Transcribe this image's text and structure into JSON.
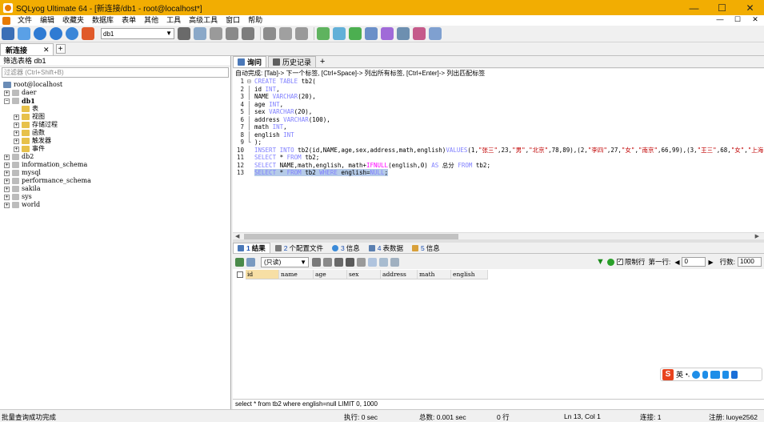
{
  "window": {
    "title": "SQLyog Ultimate 64 - [新连接/db1 - root@localhost*]",
    "minimize": "—",
    "maximize": "☐",
    "close": "✕"
  },
  "menu": {
    "items": [
      "文件",
      "编辑",
      "收藏夹",
      "数据库",
      "表单",
      "其他",
      "工具",
      "高级工具",
      "窗口",
      "帮助"
    ],
    "right": [
      "—",
      "☐",
      "✕"
    ]
  },
  "toolbar": {
    "db_select": "db1"
  },
  "connection_tab": {
    "label": "新连接",
    "close": "✕",
    "add": "+"
  },
  "left_panel": {
    "header": "筛选表格 db1",
    "filter_placeholder": "过滤器 (Ctrl+Shift+B)",
    "tree": {
      "root": "root@localhost",
      "n1": "daer",
      "n2": "db1",
      "n2a": "表",
      "n2b": "视图",
      "n2c": "存储过程",
      "n2d": "函数",
      "n2e": "触发器",
      "n2f": "事件",
      "n3": "db2",
      "n4": "information_schema",
      "n5": "mysql",
      "n6": "performance_schema",
      "n7": "sakila",
      "n8": "sys",
      "n9": "world"
    }
  },
  "editor_tabs": {
    "query": "询问",
    "history": "历史记录",
    "add": "+"
  },
  "hint": "自动完成: [Tab]-> 下一个标签, [Ctrl+Space]-> 列出所有标签, [Ctrl+Enter]-> 列出匹配标签",
  "editor": {
    "n1": "1",
    "n2": "2",
    "n3": "3",
    "n4": "4",
    "n5": "5",
    "n6": "6",
    "n7": "7",
    "n8": "8",
    "n9": "9",
    "n10": "10",
    "n11": "11",
    "n12": "12",
    "n13": "13",
    "l1_kw": "CREATE TABLE",
    "l1_rest": " tb2(",
    "l2": "id ",
    "l2_t": "INT",
    "l2_e": ",",
    "l3": "NAME ",
    "l3_t": "VARCHAR",
    "l3_e": "(20),",
    "l4": "age ",
    "l4_t": "INT",
    "l4_e": ",",
    "l5": "sex ",
    "l5_t": "VARCHAR",
    "l5_e": "(20),",
    "l6": "address ",
    "l6_t": "VARCHAR",
    "l6_e": "(100),",
    "l7": "math ",
    "l7_t": "INT",
    "l7_e": ",",
    "l8": "english ",
    "l8_t": "INT",
    "l9": ");",
    "l10_kw1": "INSERT INTO",
    "l10_a": " tb2(id,NAME,age,sex,address,math,english)",
    "l10_kw2": "VALUES",
    "l10_b": "(1,",
    "l10_s1": "\"张三\"",
    "l10_c": ",23,",
    "l10_s2": "\"男\"",
    "l10_d": ",",
    "l10_s3": "\"北京\"",
    "l10_e": ",78,89),(2,",
    "l10_s4": "\"李四\"",
    "l10_f": ",27,",
    "l10_s5": "\"女\"",
    "l10_g": ",",
    "l10_s6": "\"南京\"",
    "l10_h": ",66,99),(3,",
    "l10_s7": "\"王三\"",
    "l10_i": ",68,",
    "l10_s8": "\"女\"",
    "l10_j": ",",
    "l10_s9": "\"上海",
    "l11_kw1": "SELECT",
    "l11_a": " * ",
    "l11_kw2": "FROM",
    "l11_b": " tb2;",
    "l12_kw1": "SELECT",
    "l12_a": " NAME,math,english, math+",
    "l12_fn": "IFNULL",
    "l12_b": "(english,0) ",
    "l12_kw2": "AS",
    "l12_c": " 总分 ",
    "l12_kw3": "FROM",
    "l12_d": " tb2;",
    "l13_kw1": "SELECT",
    "l13_a": " * ",
    "l13_kw2": "FROM",
    "l13_b": " tb2 ",
    "l13_kw3": "WHERE",
    "l13_c": " english=",
    "l13_kw4": "NULL",
    "l13_d": ";"
  },
  "result_tabs": {
    "t1_n": "1",
    "t1": "结果",
    "t2_n": "2",
    "t2": "个配置文件",
    "t3_n": "3",
    "t3": "信息",
    "t4_n": "4",
    "t4": "表数据",
    "t5_n": "5",
    "t5": "信息"
  },
  "result_toolbar": {
    "readonly": "(只读)",
    "limit_label": "限制行",
    "first_row_label": "第一行:",
    "first_row": "0",
    "rows_label": "行数:",
    "rows": "1000"
  },
  "grid": {
    "columns": [
      "id",
      "name",
      "age",
      "sex",
      "address",
      "math",
      "english"
    ]
  },
  "sql_status": "select * from tb2 where english=null LIMIT 0, 1000",
  "ime": {
    "logo": "S",
    "lang": "英"
  },
  "statusbar": {
    "message": "批量查询成功完成",
    "exec": "执行: 0 sec",
    "total": "总数: 0.001 sec",
    "rows": "0 行",
    "pos": "Ln 13, Col 1",
    "conn": "连接: 1",
    "reg": "注册: luoye2562"
  },
  "colors": {
    "titlebar": "#f2ad02",
    "keyword": "#8080ff",
    "string": "#c00000",
    "function": "#ff00ff",
    "selection": "#b5cbe8"
  }
}
